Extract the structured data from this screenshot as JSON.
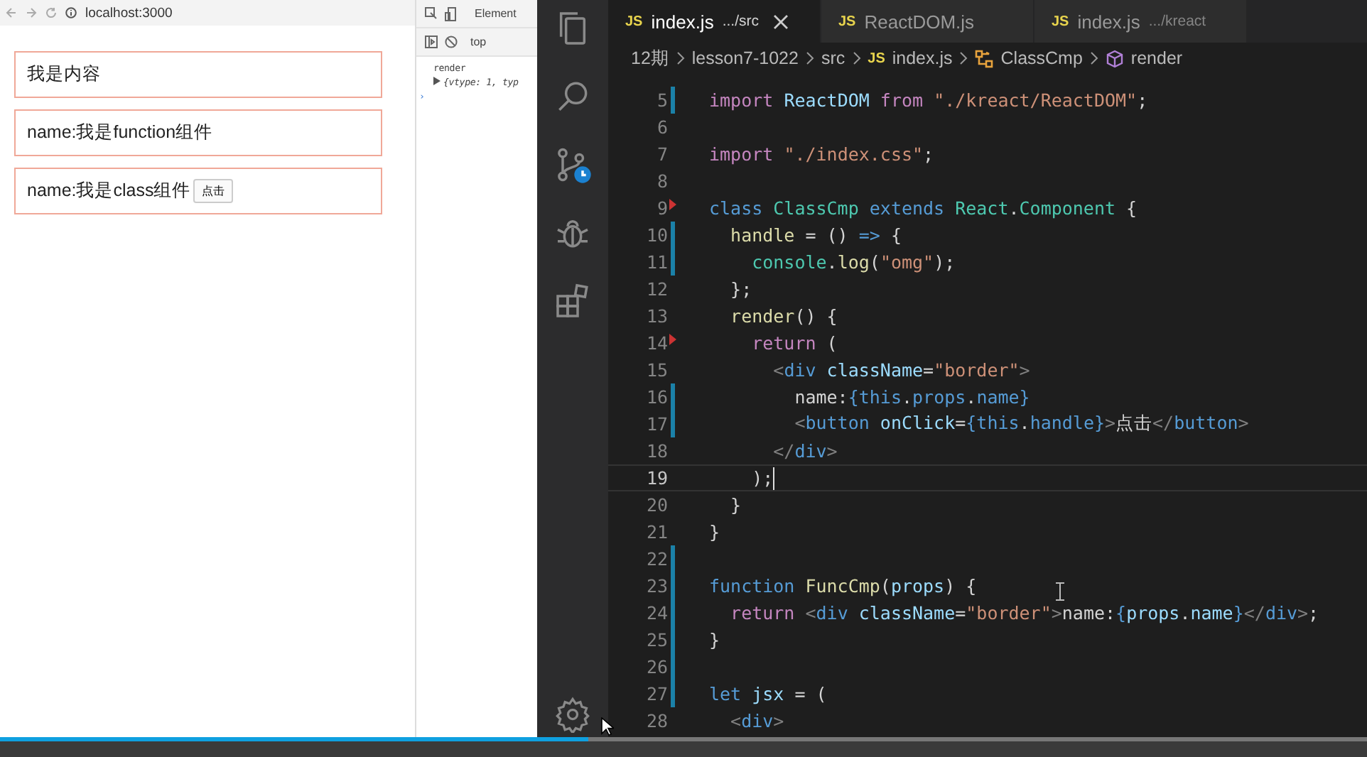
{
  "browser": {
    "address": "localhost:3000"
  },
  "page": {
    "boxes": [
      {
        "text": "我是内容"
      },
      {
        "text": "name:我是function组件"
      },
      {
        "text": "name:我是class组件",
        "button": "点击"
      }
    ]
  },
  "devtools": {
    "tab": "Element",
    "context": "top",
    "console": [
      {
        "kind": "log",
        "text": "render"
      },
      {
        "kind": "object",
        "text": "{vtype: 1, typ"
      },
      {
        "kind": "prompt",
        "text": "›"
      }
    ]
  },
  "editor": {
    "tabs": [
      {
        "badge": "JS",
        "name": "index.js",
        "path": ".../src",
        "selected": true
      },
      {
        "badge": "JS",
        "name": "ReactDOM.js",
        "selected": false
      },
      {
        "badge": "JS",
        "name": "index.js",
        "path": ".../kreact",
        "selected": false
      }
    ],
    "breadcrumbs": [
      {
        "kind": "folder",
        "text": "12期"
      },
      {
        "kind": "folder",
        "text": "lesson7-1022"
      },
      {
        "kind": "folder",
        "text": "src"
      },
      {
        "kind": "file",
        "badge": "JS",
        "text": "index.js"
      },
      {
        "kind": "class",
        "text": "ClassCmp"
      },
      {
        "kind": "method",
        "text": "render"
      }
    ],
    "lines": [
      {
        "number": "5",
        "modified": true,
        "deleted": false,
        "current": false,
        "tokens": [
          {
            "kind": "kw",
            "text": "import "
          },
          {
            "kind": "var",
            "text": "ReactDOM "
          },
          {
            "kind": "kw",
            "text": "from "
          },
          {
            "kind": "str",
            "text": "\"./kreact/ReactDOM\""
          },
          {
            "kind": "p",
            "text": ";"
          }
        ]
      },
      {
        "number": "6",
        "modified": false,
        "deleted": false,
        "current": false
      },
      {
        "number": "7",
        "modified": false,
        "deleted": false,
        "current": false,
        "tokens": [
          {
            "kind": "kw",
            "text": "import "
          },
          {
            "kind": "str",
            "text": "\"./index.css\""
          },
          {
            "kind": "p",
            "text": ";"
          }
        ]
      },
      {
        "number": "8",
        "modified": false,
        "deleted": false,
        "current": false
      },
      {
        "number": "9",
        "modified": false,
        "deleted": true,
        "current": false,
        "tokens": [
          {
            "kind": "st",
            "text": "class "
          },
          {
            "kind": "ty",
            "text": "ClassCmp "
          },
          {
            "kind": "st",
            "text": "extends "
          },
          {
            "kind": "ty",
            "text": "React"
          },
          {
            "kind": "p",
            "text": "."
          },
          {
            "kind": "ty",
            "text": "Component "
          },
          {
            "kind": "p",
            "text": "{"
          }
        ]
      },
      {
        "number": "10",
        "modified": true,
        "deleted": false,
        "current": false,
        "tokens": [
          {
            "kind": "fn",
            "text": "  handle "
          },
          {
            "kind": "p",
            "text": "= () "
          },
          {
            "kind": "st",
            "text": "=> "
          },
          {
            "kind": "p",
            "text": "{"
          }
        ]
      },
      {
        "number": "11",
        "modified": true,
        "deleted": false,
        "current": false,
        "tokens": [
          {
            "kind": "ty",
            "text": "    console"
          },
          {
            "kind": "p",
            "text": "."
          },
          {
            "kind": "fn",
            "text": "log"
          },
          {
            "kind": "p",
            "text": "("
          },
          {
            "kind": "str",
            "text": "\"omg\""
          },
          {
            "kind": "p",
            "text": ");"
          }
        ]
      },
      {
        "number": "12",
        "modified": false,
        "deleted": false,
        "current": false,
        "tokens": [
          {
            "kind": "p",
            "text": "  };"
          }
        ]
      },
      {
        "number": "13",
        "modified": false,
        "deleted": false,
        "current": false,
        "tokens": [
          {
            "kind": "fn",
            "text": "  render"
          },
          {
            "kind": "p",
            "text": "() {"
          }
        ]
      },
      {
        "number": "14",
        "modified": false,
        "deleted": true,
        "current": false,
        "tokens": [
          {
            "kind": "kw",
            "text": "    return "
          },
          {
            "kind": "p",
            "text": "("
          }
        ]
      },
      {
        "number": "15",
        "modified": false,
        "deleted": false,
        "current": false,
        "tokens": [
          {
            "kind": "tag",
            "text": "      <"
          },
          {
            "kind": "st",
            "text": "div "
          },
          {
            "kind": "var",
            "text": "className"
          },
          {
            "kind": "p",
            "text": "="
          },
          {
            "kind": "str",
            "text": "\"border\""
          },
          {
            "kind": "tag",
            "text": ">"
          }
        ]
      },
      {
        "number": "16",
        "modified": true,
        "deleted": false,
        "current": false,
        "tokens": [
          {
            "kind": "p",
            "text": "        name:"
          },
          {
            "kind": "st",
            "text": "{this"
          },
          {
            "kind": "p",
            "text": "."
          },
          {
            "kind": "st",
            "text": "props"
          },
          {
            "kind": "p",
            "text": "."
          },
          {
            "kind": "st",
            "text": "name}"
          }
        ]
      },
      {
        "number": "17",
        "modified": true,
        "deleted": false,
        "current": false,
        "tokens": [
          {
            "kind": "tag",
            "text": "        <"
          },
          {
            "kind": "st",
            "text": "button "
          },
          {
            "kind": "var",
            "text": "onClick"
          },
          {
            "kind": "p",
            "text": "="
          },
          {
            "kind": "st",
            "text": "{this"
          },
          {
            "kind": "p",
            "text": "."
          },
          {
            "kind": "st",
            "text": "handle}"
          },
          {
            "kind": "tag",
            "text": ">"
          },
          {
            "kind": "p",
            "text": "点击"
          },
          {
            "kind": "tag",
            "text": "</"
          },
          {
            "kind": "st",
            "text": "button"
          },
          {
            "kind": "tag",
            "text": ">"
          }
        ]
      },
      {
        "number": "18",
        "modified": false,
        "deleted": false,
        "current": false,
        "tokens": [
          {
            "kind": "tag",
            "text": "      </"
          },
          {
            "kind": "st",
            "text": "div"
          },
          {
            "kind": "tag",
            "text": ">"
          }
        ]
      },
      {
        "number": "19",
        "modified": false,
        "deleted": false,
        "current": true,
        "tokens": [
          {
            "kind": "p",
            "text": "    );"
          }
        ]
      },
      {
        "number": "20",
        "modified": false,
        "deleted": false,
        "current": false,
        "tokens": [
          {
            "kind": "p",
            "text": "  }"
          }
        ]
      },
      {
        "number": "21",
        "modified": false,
        "deleted": false,
        "current": false,
        "tokens": [
          {
            "kind": "p",
            "text": "}"
          }
        ]
      },
      {
        "number": "22",
        "modified": true,
        "deleted": false,
        "current": false
      },
      {
        "number": "23",
        "modified": true,
        "deleted": false,
        "current": false,
        "tokens": [
          {
            "kind": "st",
            "text": "function "
          },
          {
            "kind": "fn",
            "text": "FuncCmp"
          },
          {
            "kind": "p",
            "text": "("
          },
          {
            "kind": "var",
            "text": "props"
          },
          {
            "kind": "p",
            "text": ") {"
          }
        ]
      },
      {
        "number": "24",
        "modified": true,
        "deleted": false,
        "current": false,
        "tokens": [
          {
            "kind": "kw",
            "text": "  return "
          },
          {
            "kind": "tag",
            "text": "<"
          },
          {
            "kind": "st",
            "text": "div "
          },
          {
            "kind": "var",
            "text": "className"
          },
          {
            "kind": "p",
            "text": "="
          },
          {
            "kind": "str",
            "text": "\"border\""
          },
          {
            "kind": "tag",
            "text": ">"
          },
          {
            "kind": "p",
            "text": "name:"
          },
          {
            "kind": "st",
            "text": "{"
          },
          {
            "kind": "var",
            "text": "props"
          },
          {
            "kind": "p",
            "text": "."
          },
          {
            "kind": "var",
            "text": "name"
          },
          {
            "kind": "st",
            "text": "}"
          },
          {
            "kind": "tag",
            "text": "</"
          },
          {
            "kind": "st",
            "text": "div"
          },
          {
            "kind": "tag",
            "text": ">"
          },
          {
            "kind": "p",
            "text": ";"
          }
        ]
      },
      {
        "number": "25",
        "modified": true,
        "deleted": false,
        "current": false,
        "tokens": [
          {
            "kind": "p",
            "text": "}"
          }
        ]
      },
      {
        "number": "26",
        "modified": true,
        "deleted": false,
        "current": false
      },
      {
        "number": "27",
        "modified": true,
        "deleted": false,
        "current": false,
        "tokens": [
          {
            "kind": "st",
            "text": "let "
          },
          {
            "kind": "var",
            "text": "jsx "
          },
          {
            "kind": "p",
            "text": "= ("
          }
        ]
      },
      {
        "number": "28",
        "modified": false,
        "deleted": false,
        "current": false,
        "tokens": [
          {
            "kind": "tag",
            "text": "  <"
          },
          {
            "kind": "st",
            "text": "div"
          },
          {
            "kind": "tag",
            "text": ">"
          }
        ]
      }
    ]
  },
  "video_progress": {
    "level": 0.43
  }
}
